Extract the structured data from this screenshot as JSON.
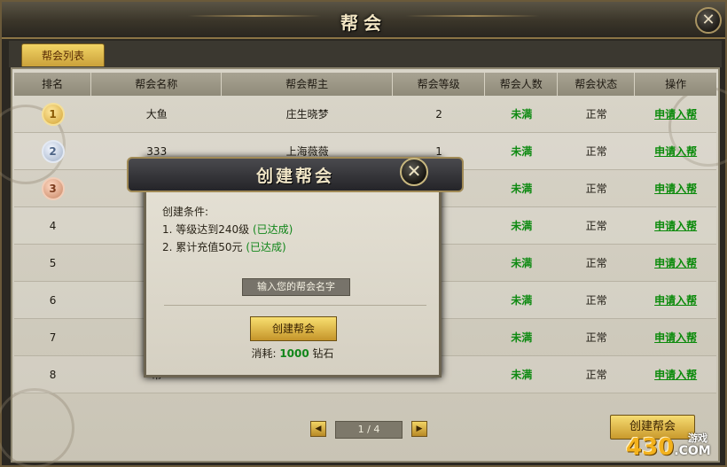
{
  "window": {
    "title": "帮会"
  },
  "tabs": [
    {
      "label": "帮会列表"
    }
  ],
  "table": {
    "headers": [
      "排名",
      "帮会名称",
      "帮会帮主",
      "帮会等级",
      "帮会人数",
      "帮会状态",
      "操作"
    ],
    "rows": [
      {
        "rank": "1",
        "name": "大鱼",
        "leader": "庄生晓梦",
        "level": "2",
        "members": "未满",
        "status": "正常",
        "action": "申请入帮"
      },
      {
        "rank": "2",
        "name": "333",
        "leader": "上海薇薇",
        "level": "1",
        "members": "未满",
        "status": "正常",
        "action": "申请入帮"
      },
      {
        "rank": "3",
        "name": "",
        "leader": "",
        "level": "",
        "members": "未满",
        "status": "正常",
        "action": "申请入帮"
      },
      {
        "rank": "4",
        "name": "",
        "leader": "",
        "level": "",
        "members": "未满",
        "status": "正常",
        "action": "申请入帮"
      },
      {
        "rank": "5",
        "name": "",
        "leader": "",
        "level": "",
        "members": "未满",
        "status": "正常",
        "action": "申请入帮"
      },
      {
        "rank": "6",
        "name": "",
        "leader": "",
        "level": "",
        "members": "未满",
        "status": "正常",
        "action": "申请入帮"
      },
      {
        "rank": "7",
        "name": "",
        "leader": "",
        "level": "",
        "members": "未满",
        "status": "正常",
        "action": "申请入帮"
      },
      {
        "rank": "8",
        "name": "帮",
        "leader": "",
        "level": "",
        "members": "未满",
        "status": "正常",
        "action": "申请入帮"
      }
    ]
  },
  "pager": {
    "text": "1 / 4",
    "prev_icon": "arrow-left-icon",
    "next_icon": "arrow-right-icon"
  },
  "create_button": "创建帮会",
  "logo": {
    "main": "430",
    "sub": "游戏",
    "suffix": ".COM"
  },
  "modal": {
    "title": "创建帮会",
    "conditions_label": "创建条件:",
    "conditions": [
      {
        "text": "1. 等级达到240级",
        "status": "(已达成)"
      },
      {
        "text": "2. 累计充值50元",
        "status": "(已达成)"
      }
    ],
    "input_placeholder": "输入您的帮会名字",
    "create_label": "创建帮会",
    "cost_label": "消耗:",
    "cost_amount": "1000",
    "cost_unit": "钻石"
  },
  "colors": {
    "accent_gold": "#e8c54e",
    "status_green": "#0e8a12",
    "frame_dark": "#2b2822"
  }
}
